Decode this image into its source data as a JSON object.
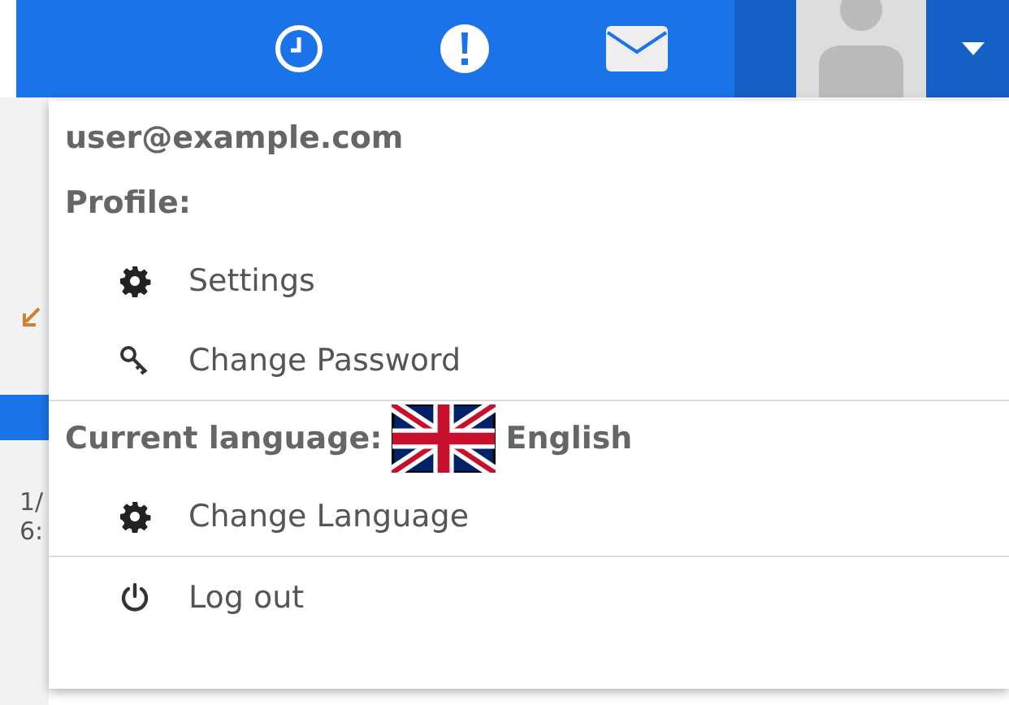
{
  "background": {
    "texts": [
      "1/",
      "6:"
    ]
  },
  "menu": {
    "email": "user@example.com",
    "groups": [
      {
        "heading": "Profile:",
        "items": [
          {
            "kind": "gear",
            "label": "Settings"
          },
          {
            "kind": "key",
            "label": "Change Password"
          }
        ]
      },
      {
        "heading": "Current language:",
        "language": "English",
        "items": [
          {
            "kind": "gear",
            "label": "Change Language"
          }
        ]
      },
      {
        "items": [
          {
            "kind": "power",
            "label": "Log out"
          }
        ]
      }
    ]
  }
}
